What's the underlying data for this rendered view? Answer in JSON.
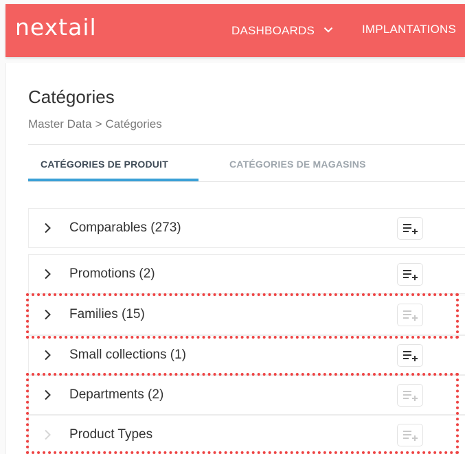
{
  "header": {
    "logo": "nextail",
    "nav": {
      "dashboards": "DASHBOARDS",
      "implantations": "IMPLANTATIONS"
    }
  },
  "page": {
    "title": "Catégories",
    "breadcrumb": {
      "root": "Master Data",
      "separator": ">",
      "current": "Catégories"
    }
  },
  "tabs": {
    "products": "CATÉGORIES DE PRODUIT",
    "stores": "CATÉGORIES DE MAGASINS",
    "active": "products"
  },
  "categories": [
    {
      "label": "Comparables (273)",
      "expandable": true,
      "add_enabled": true
    },
    {
      "label": "Promotions (2)",
      "expandable": true,
      "add_enabled": true
    },
    {
      "label": "Families (15)",
      "expandable": true,
      "add_enabled": false
    },
    {
      "label": "Small collections (1)",
      "expandable": true,
      "add_enabled": true
    },
    {
      "label": "Departments (2)",
      "expandable": true,
      "add_enabled": false
    },
    {
      "label": "Product Types",
      "expandable": false,
      "add_enabled": false
    }
  ],
  "icons": {
    "row_expand": "chevron-right-icon",
    "add_sub": "add-subcategory-icon",
    "nav_dropdown": "chevron-down-icon"
  },
  "colors": {
    "brand": "#f3605f",
    "accent": "#3aa0d6",
    "highlight": "#ee4444",
    "text": "#333333",
    "muted": "#9ea6ad"
  }
}
